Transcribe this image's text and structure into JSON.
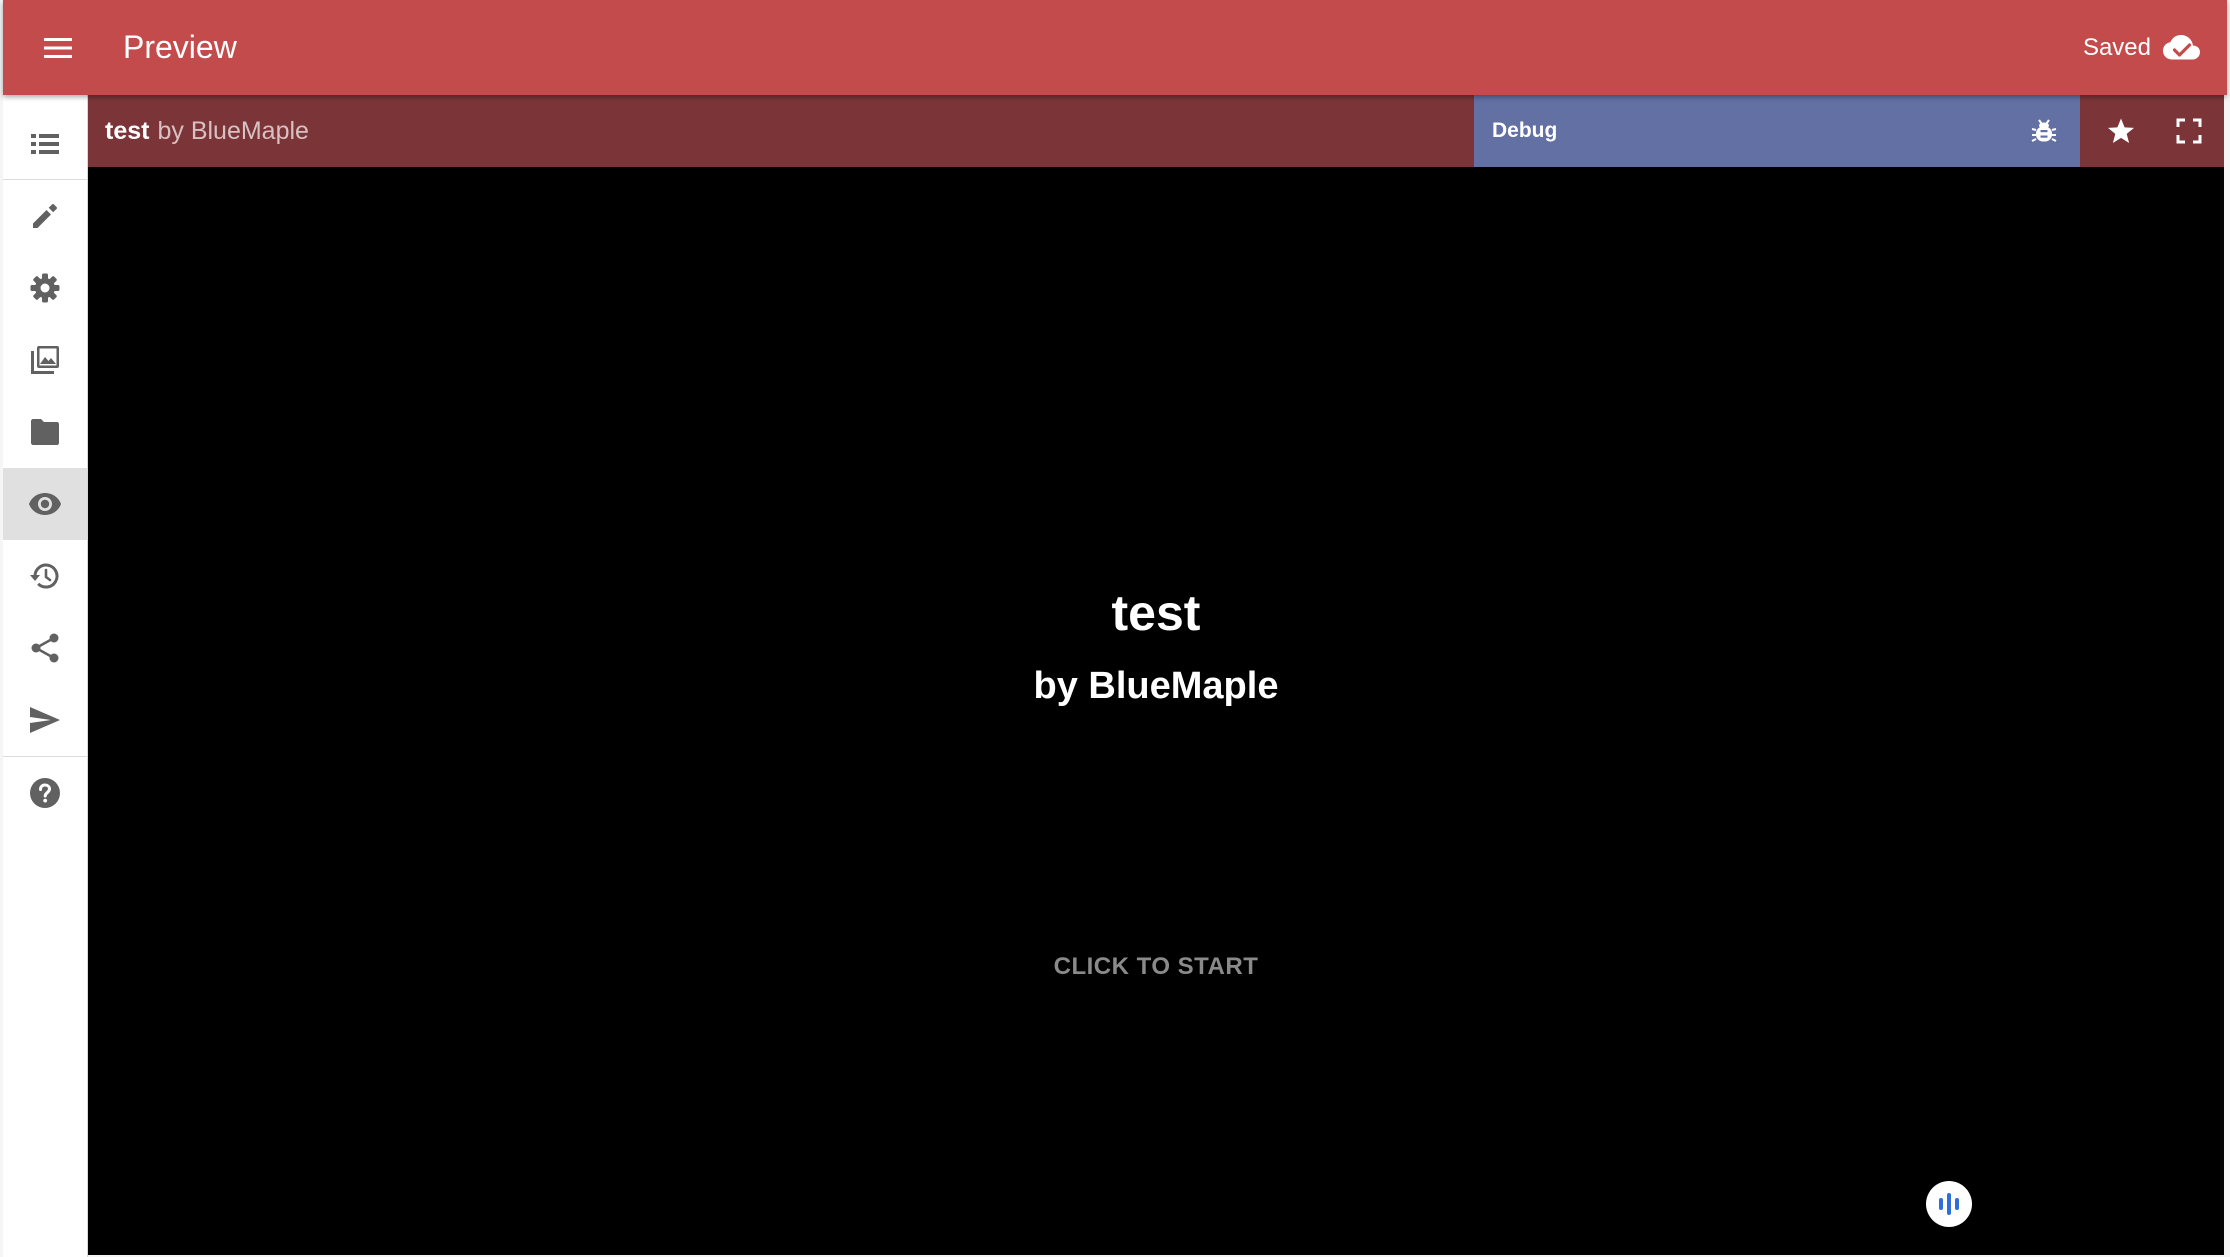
{
  "app": {
    "title": "Preview",
    "save_status": "Saved"
  },
  "sidebar": {
    "items": [
      {
        "name": "list-icon"
      },
      {
        "name": "pencil-icon"
      },
      {
        "name": "gear-icon"
      },
      {
        "name": "images-icon"
      },
      {
        "name": "folder-icon"
      },
      {
        "name": "eye-icon",
        "active": true
      },
      {
        "name": "history-icon"
      },
      {
        "name": "share-icon"
      },
      {
        "name": "send-icon"
      },
      {
        "name": "help-icon"
      }
    ]
  },
  "story_bar": {
    "title": "test",
    "author": "by BlueMaple",
    "debug_label": "Debug"
  },
  "game": {
    "title": "test",
    "author": "by BlueMaple",
    "start_prompt": "CLICK TO START"
  },
  "colors": {
    "topbar": "#c44b4b",
    "story_bar": "#7b3539",
    "debug_panel": "#6270a4",
    "sidebar_icon": "#616161",
    "audio_icon": "#2f6fd6"
  }
}
